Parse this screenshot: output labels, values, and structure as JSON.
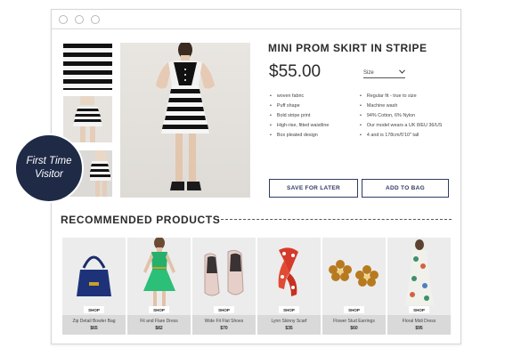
{
  "product": {
    "name": "MINI PROM SKIRT IN STRIPE",
    "price": "$55.00",
    "size_label": "Size",
    "features_left": [
      "woven fabric",
      "Puff shape",
      "Bold stripe print",
      "High-rise, fitted waistline",
      "Box pleated design"
    ],
    "features_right": [
      "Regular fit - true to size",
      "Machine wash",
      "94% Cotton, 6% Nylon",
      "Our model wears a UK 8/EU 36/US",
      "4 and is 178cm/5'10\" tall"
    ],
    "save_label": "SAVE FOR LATER",
    "add_label": "ADD TO BAG"
  },
  "recommended": {
    "title": "RECOMMENDED PRODUCTS",
    "shop_label": "SHOP",
    "items": [
      {
        "name": "Zip Detail Bowler Bag",
        "price": "$65"
      },
      {
        "name": "Fit and Flare Dress",
        "price": "$82"
      },
      {
        "name": "Wide Fit Flat Shoes",
        "price": "$70"
      },
      {
        "name": "Lynn Skinny Scarf",
        "price": "$35"
      },
      {
        "name": "Flower Stud Earrings",
        "price": "$60"
      },
      {
        "name": "Floral Midi Dress",
        "price": "$95"
      }
    ]
  },
  "badge": {
    "line1": "First Time",
    "line2": "Visitor"
  },
  "colors": {
    "accent": "#2f3c63",
    "badge_bg": "#1f2a47"
  },
  "icons": [
    "chevron-down-icon",
    "window-dot-icon"
  ]
}
